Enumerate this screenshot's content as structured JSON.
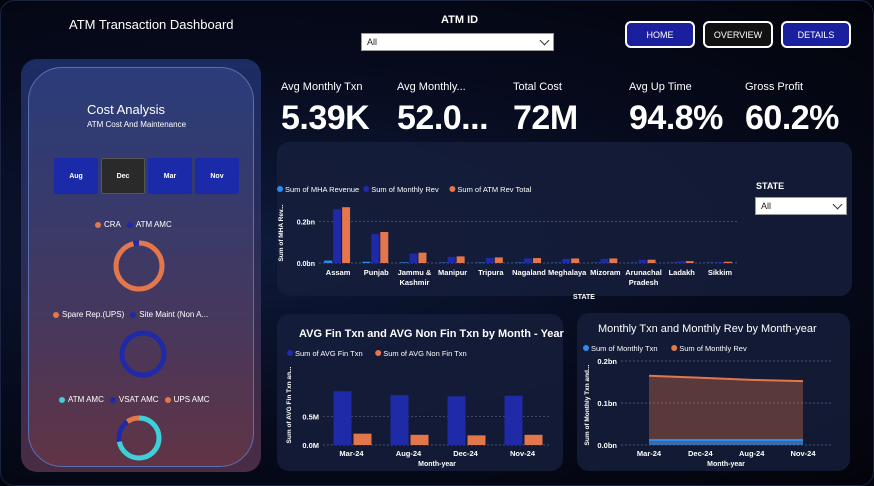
{
  "header": {
    "title": "ATM Transaction Dashboard",
    "atm_id_label": "ATM ID",
    "atm_id_value": "All",
    "nav": [
      "HOME",
      "OVERVIEW",
      "DETAILS"
    ]
  },
  "cost_analysis": {
    "title": "Cost Analysis",
    "subtitle": "ATM Cost And Maintenance",
    "months": [
      "Aug",
      "Dec",
      "Mar",
      "Nov"
    ],
    "donut1_legend": [
      {
        "label": "CRA",
        "color": "#e3764b"
      },
      {
        "label": "ATM AMC",
        "color": "#1e2aa8"
      }
    ],
    "donut1": {
      "values": [
        96,
        4
      ],
      "colors": [
        "#e3764b",
        "#1e2aa8"
      ]
    },
    "donut2_legend": [
      {
        "label": "Spare Rep.(UPS)",
        "color": "#e3764b"
      },
      {
        "label": "Site Maint (Non A...",
        "color": "#1e2aa8"
      }
    ],
    "donut2": {
      "values": [
        100
      ],
      "colors": [
        "#1e2aa8"
      ]
    },
    "donut3_legend": [
      {
        "label": "ATM AMC",
        "color": "#3ed0d8"
      },
      {
        "label": "VSAT AMC",
        "color": "#1e2aa8"
      },
      {
        "label": "UPS AMC",
        "color": "#e3764b"
      }
    ],
    "donut3": {
      "values": [
        72,
        18,
        10
      ],
      "colors": [
        "#3ed0d8",
        "#1e2aa8",
        "#e3764b"
      ]
    }
  },
  "kpis": [
    {
      "label": "Avg Monthly Txn",
      "value": "5.39K"
    },
    {
      "label": "Avg Monthly...",
      "value": "52.0..."
    },
    {
      "label": "Total Cost",
      "value": "72M"
    },
    {
      "label": "Avg Up Time",
      "value": "94.8%"
    },
    {
      "label": "Gross Profit",
      "value": "60.2%"
    }
  ],
  "state_filter": {
    "label": "STATE",
    "value": "All"
  },
  "colors": {
    "blue": "#1e2aa8",
    "orange": "#e3764b",
    "light_blue": "#2a8cf0"
  },
  "chart_data": [
    {
      "type": "bar",
      "xlabel": "STATE",
      "ylabel": "Sum of MHA Rev...",
      "ylim": [
        0,
        0.3
      ],
      "yticks": [
        "0.0bn",
        "0.2bn"
      ],
      "categories": [
        "Assam",
        "Punjab",
        "Jammu & Kashmir",
        "Manipur",
        "Tripura",
        "Nagaland",
        "Meghalaya",
        "Mizoram",
        "Arunachal Pradesh",
        "Ladakh",
        "Sikkim"
      ],
      "series": [
        {
          "name": "Sum of MHA Revenue",
          "color": "#2a8cf0",
          "values": [
            0.012,
            0.006,
            0.003,
            0.002,
            0.002,
            0.002,
            0.001,
            0.001,
            0.001,
            0.001,
            0.001
          ]
        },
        {
          "name": "Sum of Monthly Rev",
          "color": "#1e2aa8",
          "values": [
            0.26,
            0.14,
            0.045,
            0.03,
            0.025,
            0.022,
            0.02,
            0.02,
            0.015,
            0.008,
            0.005
          ]
        },
        {
          "name": "Sum of ATM Rev Total",
          "color": "#e3764b",
          "values": [
            0.27,
            0.15,
            0.05,
            0.032,
            0.027,
            0.024,
            0.022,
            0.022,
            0.016,
            0.009,
            0.006
          ]
        }
      ]
    },
    {
      "type": "bar",
      "title": "AVG Fin Txn and AVG Non Fin Txn by Month - Year",
      "xlabel": "Month-year",
      "ylabel": "Sum of AVG Fin Txn an...",
      "ylim": [
        0,
        1.2
      ],
      "yticks": [
        "0.0M",
        "0.5M"
      ],
      "categories": [
        "Mar-24",
        "Aug-24",
        "Dec-24",
        "Nov-24"
      ],
      "series": [
        {
          "name": "Sum of AVG Fin Txn",
          "color": "#1e2aa8",
          "values": [
            0.95,
            0.88,
            0.86,
            0.87
          ]
        },
        {
          "name": "Sum of AVG Non Fin Txn",
          "color": "#e3764b",
          "values": [
            0.2,
            0.18,
            0.17,
            0.18
          ]
        }
      ]
    },
    {
      "type": "area",
      "title": "Monthly Txn and Monthly Rev by Month-year",
      "xlabel": "Month-year",
      "ylabel": "Sum of Monthly Txn and...",
      "ylim": [
        0,
        0.2
      ],
      "yticks": [
        "0.0bn",
        "0.1bn",
        "0.2bn"
      ],
      "categories": [
        "Mar-24",
        "Dec-24",
        "Aug-24",
        "Nov-24"
      ],
      "series": [
        {
          "name": "Sum of Monthly Txn",
          "color": "#2a8cf0",
          "values": [
            0.012,
            0.012,
            0.012,
            0.012
          ]
        },
        {
          "name": "Sum of Monthly Rev",
          "color": "#e3764b",
          "values": [
            0.165,
            0.16,
            0.155,
            0.152
          ]
        }
      ]
    }
  ]
}
